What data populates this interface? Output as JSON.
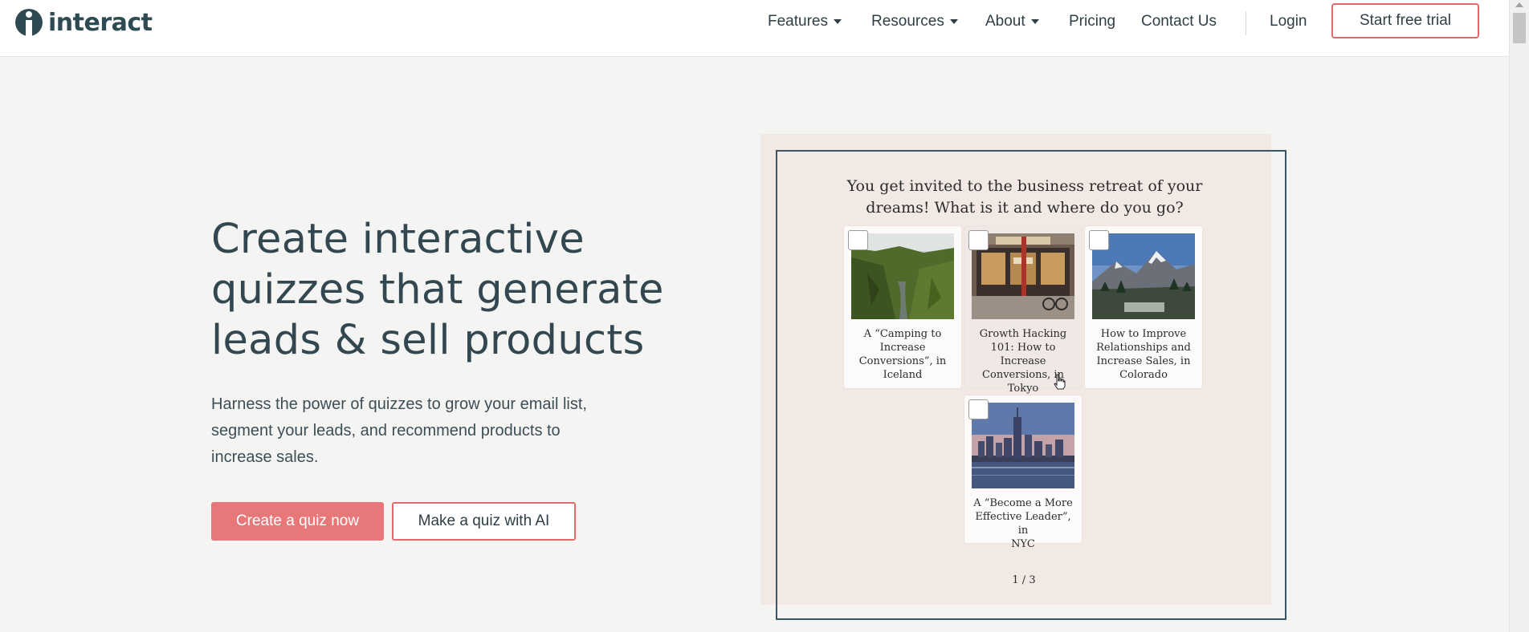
{
  "brand": {
    "name": "interact"
  },
  "nav": {
    "items": [
      {
        "label": "Features",
        "has_dropdown": true
      },
      {
        "label": "Resources",
        "has_dropdown": true
      },
      {
        "label": "About",
        "has_dropdown": true
      },
      {
        "label": "Pricing",
        "has_dropdown": false
      },
      {
        "label": "Contact Us",
        "has_dropdown": false
      }
    ],
    "login": "Login",
    "cta": "Start free trial"
  },
  "hero": {
    "title_lines": [
      "Create interactive",
      "quizzes that generate",
      "leads & sell products"
    ],
    "subtitle_lines": [
      "Harness the power of quizzes to grow your email list,",
      "segment your leads, and recommend products to",
      "increase sales."
    ],
    "primary_button": "Create a quiz now",
    "secondary_button": "Make a quiz with AI"
  },
  "quiz": {
    "question_lines": [
      "You get invited to the business retreat of your",
      "dreams! What is it and where do you go?"
    ],
    "options": [
      {
        "label_lines": [
          "A “Camping to",
          "Increase",
          "Conversions”, in",
          "Iceland"
        ],
        "image": "iceland-canyon-photo",
        "checked": false
      },
      {
        "label_lines": [
          "Growth Hacking",
          "101: How to Increase",
          "Conversions, in",
          "Tokyo"
        ],
        "image": "tokyo-storefront-photo",
        "checked": false
      },
      {
        "label_lines": [
          "How to Improve",
          "Relationships and",
          "Increase Sales, in",
          "Colorado"
        ],
        "image": "colorado-mountains-photo",
        "checked": false
      },
      {
        "label_lines": [
          "A “Become a More",
          "Effective Leader”, in",
          "NYC"
        ],
        "image": "nyc-skyline-photo",
        "checked": false
      }
    ],
    "pager": "1 / 3"
  },
  "colors": {
    "accent": "#e8777a",
    "accent_border": "#e36a6a",
    "heading": "#32474f",
    "page_bg": "#f4f4f3",
    "quiz_bg": "#f2e9e5",
    "quiz_frame": "#3b5663"
  }
}
